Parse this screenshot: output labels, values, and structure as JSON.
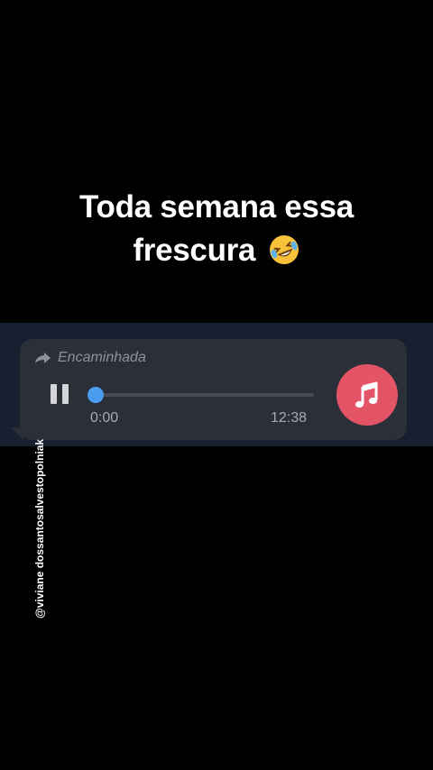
{
  "caption": {
    "line1": "Toda semana essa",
    "line2": "frescura",
    "emoji": "rolling-on-floor-laughing-icon"
  },
  "message": {
    "forwarded_label": "Encaminhada",
    "forward_icon": "forward-arrow-icon",
    "player": {
      "state_icon": "pause-icon",
      "current_time": "0:00",
      "duration": "12:38",
      "progress": 0,
      "accent_color": "#4a9cf0",
      "file_icon": "music-note-icon",
      "file_icon_bg": "#e35467"
    }
  },
  "watermark": "@viviane dossantosalvestopolniak",
  "colors": {
    "background": "#000000",
    "chat_strip": "#172030",
    "bubble": "#2b2f37"
  }
}
